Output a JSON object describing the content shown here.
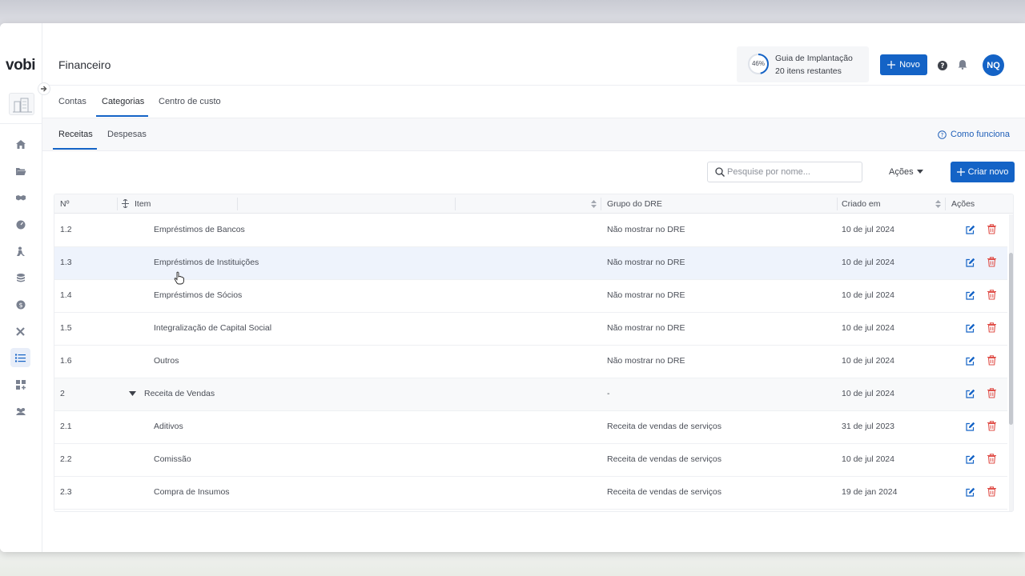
{
  "app": {
    "logo": "vobi",
    "title": "Financeiro"
  },
  "guide": {
    "percent": "46%",
    "progress": 0.46,
    "title": "Guia de Implantação",
    "subtitle": "20 itens restantes"
  },
  "header": {
    "new_label": "Novo",
    "avatar_initials": "NQ"
  },
  "tabs": [
    {
      "label": "Contas",
      "active": false
    },
    {
      "label": "Categorias",
      "active": true
    },
    {
      "label": "Centro de custo",
      "active": false
    }
  ],
  "subtabs": [
    {
      "label": "Receitas",
      "active": true
    },
    {
      "label": "Despesas",
      "active": false
    }
  ],
  "help_link": "Como funciona",
  "toolbar": {
    "search_placeholder": "Pesquise por nome...",
    "actions_label": "Ações",
    "create_label": "Criar novo"
  },
  "table": {
    "columns": {
      "num": "Nº",
      "item": "Item",
      "dre": "Grupo do DRE",
      "created": "Criado em",
      "actions": "Ações"
    },
    "rows": [
      {
        "num": "1.2",
        "item": "Empréstimos de Bancos",
        "dre": "Não mostrar no DRE",
        "created": "10 de jul 2024"
      },
      {
        "num": "1.3",
        "item": "Empréstimos de Instituições",
        "dre": "Não mostrar no DRE",
        "created": "10 de jul 2024"
      },
      {
        "num": "1.4",
        "item": "Empréstimos de Sócios",
        "dre": "Não mostrar no DRE",
        "created": "10 de jul 2024"
      },
      {
        "num": "1.5",
        "item": "Integralização de Capital Social",
        "dre": "Não mostrar no DRE",
        "created": "10 de jul 2024"
      },
      {
        "num": "1.6",
        "item": "Outros",
        "dre": "Não mostrar no DRE",
        "created": "10 de jul 2024"
      },
      {
        "num": "2",
        "item": "Receita de Vendas",
        "dre": "-",
        "created": "10 de jul 2024"
      },
      {
        "num": "2.1",
        "item": "Aditivos",
        "dre": "Receita de vendas de serviços",
        "created": "31 de jul 2023"
      },
      {
        "num": "2.2",
        "item": "Comissão",
        "dre": "Receita de vendas de serviços",
        "created": "10 de jul 2024"
      },
      {
        "num": "2.3",
        "item": "Compra de Insumos",
        "dre": "Receita de vendas de serviços",
        "created": "19 de jan 2024"
      }
    ]
  },
  "colors": {
    "primary": "#1463c6",
    "danger": "#e0504a",
    "hover_row": "#eef3fc"
  },
  "sidebar_icons": [
    "home-icon",
    "folder-icon",
    "handshake-icon",
    "dashboard-icon",
    "worker-icon",
    "stack-icon",
    "dollar-icon",
    "tools-icon",
    "list-icon",
    "apps-icon",
    "team-icon"
  ]
}
